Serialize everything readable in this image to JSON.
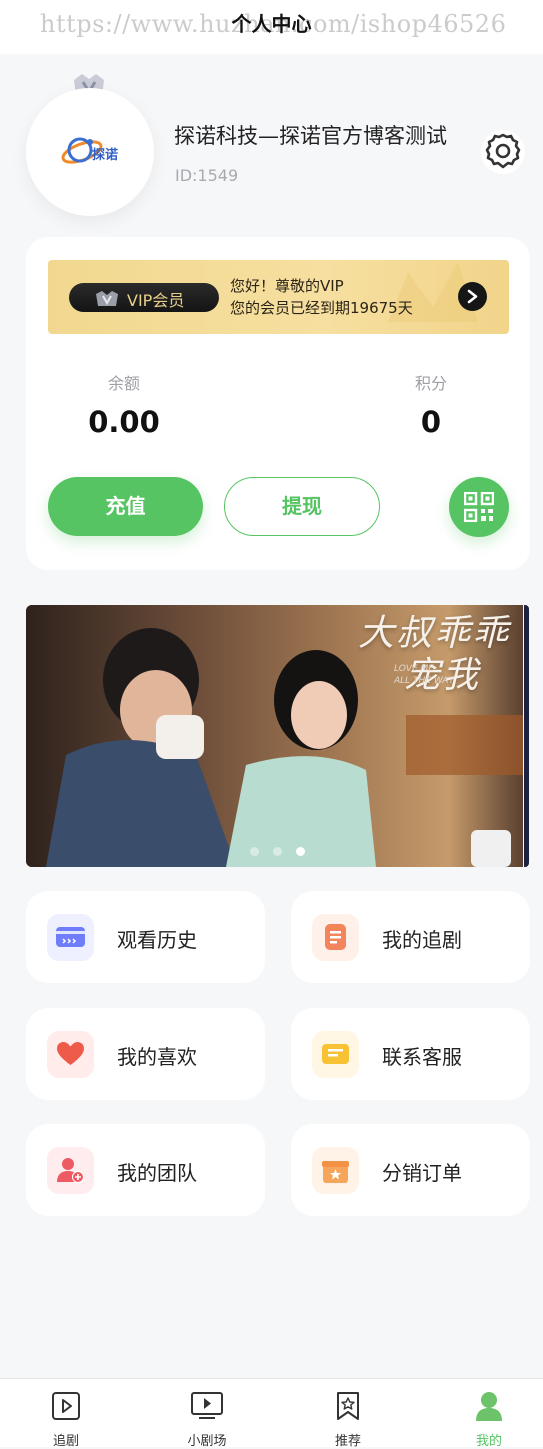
{
  "header": {
    "title": "个人中心",
    "watermark": "https://www.huzhan.com/ishop46526"
  },
  "profile": {
    "name": "探诺科技—探诺官方博客测试",
    "id": "ID:1549",
    "logo_text": "探诺"
  },
  "vip": {
    "badge": "VIP会员",
    "greeting": "您好！尊敬的VIP",
    "status": "您的会员已经到期19675天"
  },
  "wallet": {
    "balance_label": "余额",
    "balance_value": "0.00",
    "points_label": "积分",
    "points_value": "0",
    "charge_label": "充值",
    "withdraw_label": "提现"
  },
  "banner": {
    "title_line1": "大叔乖乖",
    "title_line2": "宠我",
    "subtitle_line1": "LOVE ME",
    "subtitle_line2": "ALL THE WAY",
    "slides": 3,
    "active_slide": 2
  },
  "menu": {
    "history": "观看历史",
    "following": "我的追剧",
    "likes": "我的喜欢",
    "support": "联系客服",
    "team": "我的团队",
    "orders": "分销订单"
  },
  "colors": {
    "accent": "#57c463",
    "vip_gold": "#f2d88f"
  },
  "tabs": [
    {
      "label": "追剧",
      "icon": "play-square-icon"
    },
    {
      "label": "小剧场",
      "icon": "tv-play-icon"
    },
    {
      "label": "推荐",
      "icon": "bookmark-star-icon"
    },
    {
      "label": "我的",
      "icon": "user-icon",
      "active": true
    }
  ]
}
